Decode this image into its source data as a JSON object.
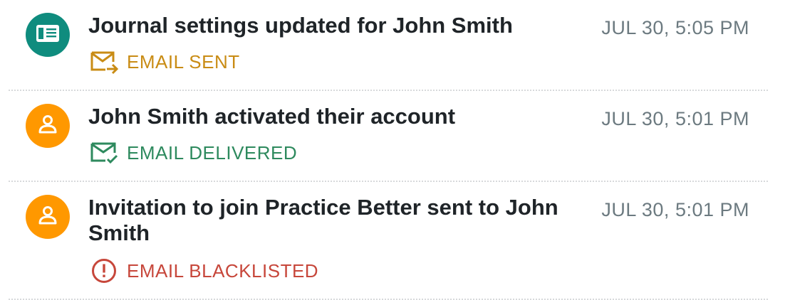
{
  "colors": {
    "teal": "#0f8c7e",
    "orange": "#ff9800",
    "sent": "#c98c15",
    "delivered": "#2e8a5e",
    "blacklisted": "#c7473b"
  },
  "activities": [
    {
      "title": "Journal settings updated for John Smith",
      "timestamp": "JUL 30, 5:05 PM",
      "avatar_icon": "journal-icon",
      "status_icon": "email-sent-icon",
      "status": "EMAIL SENT"
    },
    {
      "title": "John Smith activated their account",
      "timestamp": "JUL 30, 5:01 PM",
      "avatar_icon": "person-icon",
      "status_icon": "email-delivered-icon",
      "status": "EMAIL DELIVERED"
    },
    {
      "title": "Invitation to join Practice Better sent to John Smith",
      "timestamp": "JUL 30, 5:01 PM",
      "avatar_icon": "person-icon",
      "status_icon": "alert-circle-icon",
      "status": "EMAIL BLACKLISTED"
    }
  ]
}
